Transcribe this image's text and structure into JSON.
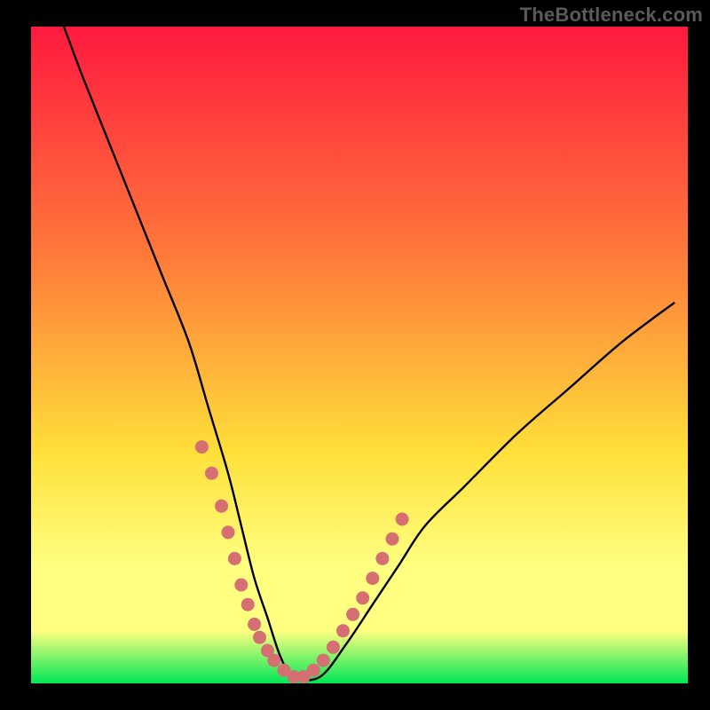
{
  "watermark": "TheBottleneck.com",
  "colors": {
    "background": "#000000",
    "grad_top": "#ff193f",
    "grad_mid1": "#ff7a3a",
    "grad_mid2": "#ffe03a",
    "grad_lowband": "#ffff80",
    "grad_green": "#00e756",
    "curve": "#000000",
    "dots": "#d66f72"
  },
  "chart_data": {
    "type": "line",
    "title": "",
    "xlabel": "",
    "ylabel": "",
    "xlim": [
      0,
      100
    ],
    "ylim": [
      0,
      100
    ],
    "series": [
      {
        "name": "bottleneck-curve",
        "x": [
          5,
          8,
          12,
          16,
          20,
          24,
          27,
          30,
          32,
          34,
          36,
          38,
          40,
          44,
          48,
          52,
          56,
          60,
          66,
          74,
          82,
          90,
          98
        ],
        "y": [
          100,
          92,
          82,
          72,
          62,
          52,
          42,
          32,
          24,
          16,
          10,
          4,
          1,
          1,
          6,
          12,
          18,
          24,
          30,
          38,
          45,
          52,
          58
        ]
      }
    ],
    "marker_points": {
      "name": "highlight-dots",
      "x": [
        26,
        27.5,
        29,
        30,
        31,
        32,
        33,
        34,
        34.8,
        36,
        37,
        38.5,
        40,
        41.5,
        43,
        44.5,
        46,
        47.5,
        49,
        50.5,
        52,
        53.5,
        55,
        56.5
      ],
      "y": [
        36,
        32,
        27,
        23,
        19,
        15,
        12,
        9,
        7,
        5,
        3.5,
        2,
        1,
        1,
        2,
        3.5,
        5.5,
        8,
        10.5,
        13,
        16,
        19,
        22,
        25
      ]
    }
  }
}
